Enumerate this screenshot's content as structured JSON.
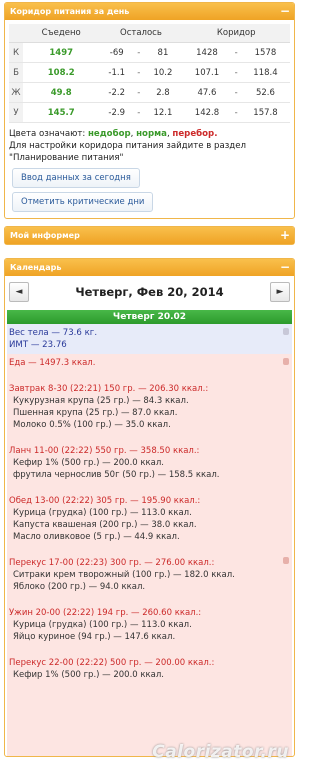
{
  "corridor": {
    "title": "Коридор питания за день",
    "toggle": "−",
    "headers": [
      "",
      "Съедено",
      "Осталось",
      "",
      "Коридор",
      ""
    ],
    "rows": [
      {
        "label": "К",
        "eaten": "1497",
        "rem_min": "-69",
        "rem_sep": "-",
        "rem_max": "81",
        "cor_min": "1428",
        "cor_sep": "-",
        "cor_max": "1578"
      },
      {
        "label": "Б",
        "eaten": "108.2",
        "rem_min": "-1.1",
        "rem_sep": "-",
        "rem_max": "10.2",
        "cor_min": "107.1",
        "cor_sep": "-",
        "cor_max": "118.4"
      },
      {
        "label": "Ж",
        "eaten": "49.8",
        "rem_min": "-2.2",
        "rem_sep": "-",
        "rem_max": "2.8",
        "cor_min": "47.6",
        "cor_sep": "-",
        "cor_max": "52.6"
      },
      {
        "label": "У",
        "eaten": "145.7",
        "rem_min": "-2.9",
        "rem_sep": "-",
        "rem_max": "12.1",
        "cor_min": "142.8",
        "cor_sep": "-",
        "cor_max": "157.8"
      }
    ],
    "legend_prefix": "Цвета означают:",
    "legend_under": "недобор",
    "legend_norm": "норма",
    "legend_over": "перебор.",
    "note": "Для настройки коридора питания зайдите в раздел \"Планирование питания\"",
    "btn_today": "Ввод данных за сегодня",
    "btn_critical": "Отметить критические дни"
  },
  "informer": {
    "title": "Мой информер",
    "toggle": "+"
  },
  "calendar": {
    "title": "Календарь",
    "toggle": "−",
    "prev": "◄",
    "next": "►",
    "date_title": "Четверг, Фев 20, 2014",
    "day_bar": "Четверг 20.02",
    "weight": "Вес тела — 73.6 кг.",
    "bmi": "ИМТ — 23.76",
    "food_total": "Еда — 1497.3 ккал.",
    "meals": [
      {
        "title": "Завтрак 8-30 (22:21) 150 гр. — 206.30 ккал.:",
        "items": [
          "Кукурузная крупа (25 гр.) — 84.3 ккал.",
          "Пшенная крупа (25 гр.) — 87.0 ккал.",
          "Молоко 0.5% (100 гр.) — 35.0 ккал."
        ]
      },
      {
        "title": "Ланч 11-00 (22:22) 550 гр. — 358.50 ккал.:",
        "items": [
          "Кефир 1% (500 гр.) — 200.0 ккал.",
          "фрутила чернослив 50г (50 гр.) — 158.5 ккал."
        ]
      },
      {
        "title": "Обед 13-00 (22:22) 305 гр. — 195.90 ккал.:",
        "items": [
          "Курица (грудка) (100 гр.) — 113.0 ккал.",
          "Капуста квашеная (200 гр.) — 38.0 ккал.",
          "Масло оливковое (5 гр.) — 44.9 ккал."
        ]
      },
      {
        "title": "Перекус 17-00 (22:23) 300 гр. — 276.00 ккал.:",
        "items": [
          "Ситраки крем творожный (100 гр.) — 182.0 ккал.",
          "Яблоко (200 гр.) — 94.0 ккал."
        ]
      },
      {
        "title": "Ужин 20-00 (22:22) 194 гр. — 260.60 ккал.:",
        "items": [
          "Курица (грудка) (100 гр.) — 113.0 ккал.",
          "Яйцо куриное (94 гр.) — 147.6 ккал."
        ]
      },
      {
        "title": "Перекус 22-00 (22:22) 500 гр. — 200.00 ккал.:",
        "items": [
          "Кефир 1% (500 гр.) — 200.0 ккал."
        ]
      }
    ]
  },
  "watermark": "Calorizator.ru",
  "colors": {
    "accent": "#f0b64a",
    "green": "#3a9a2a",
    "red": "#cc2a2a"
  }
}
